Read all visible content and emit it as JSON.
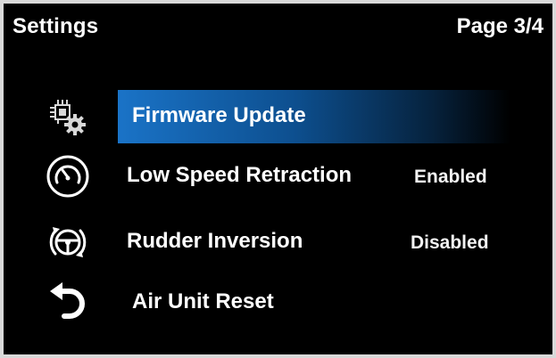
{
  "header": {
    "title": "Settings",
    "page": "Page 3/4"
  },
  "menu": {
    "items": [
      {
        "label": "Firmware Update",
        "value": "",
        "icon": "firmware-chip-gear-icon",
        "selected": true
      },
      {
        "label": "Low Speed Retraction",
        "value": "Enabled",
        "icon": "speed-gauge-icon",
        "selected": false
      },
      {
        "label": "Rudder Inversion",
        "value": "Disabled",
        "icon": "steering-wheel-rotate-icon",
        "selected": false
      },
      {
        "label": "Air Unit Reset",
        "value": "",
        "icon": "reset-arrow-icon",
        "selected": false
      }
    ]
  },
  "colors": {
    "background": "#000000",
    "highlight": "#1a73c7",
    "text": "#ffffff"
  }
}
